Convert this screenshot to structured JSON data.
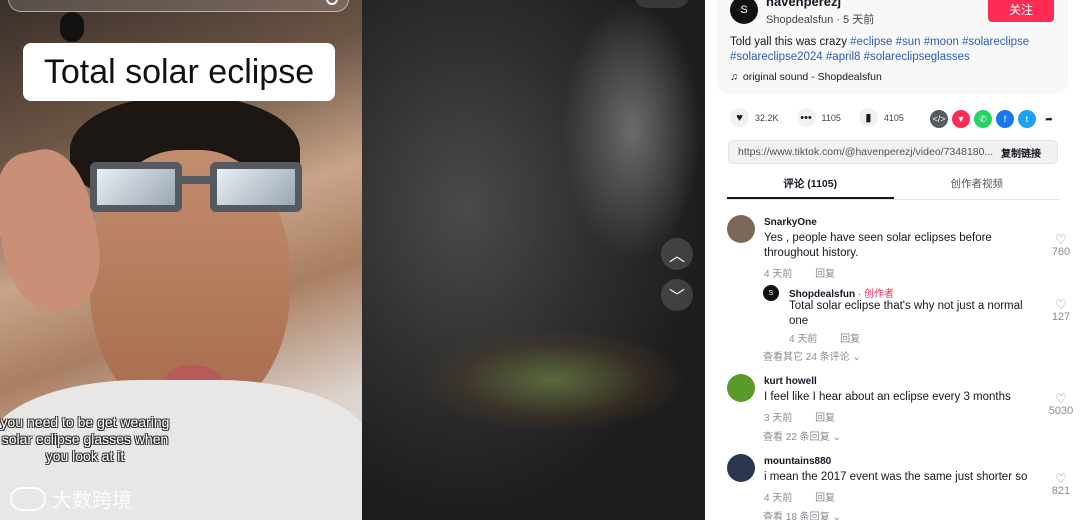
{
  "video": {
    "overlay_title": "Total solar eclipse",
    "caption": "you need to be get wearing solar eclipse glasses when you look at it",
    "watermark": "大数跨境"
  },
  "author": {
    "avatar_text": "S",
    "username": "havenperezj",
    "subline": "Shopdealsfun · 5 天前",
    "follow_label": "关注"
  },
  "post": {
    "text": "Told yall this was crazy",
    "hashtags": [
      "#eclipse",
      "#sun",
      "#moon",
      "#solareclipse",
      "#solareclipse2024",
      "#april8",
      "#solareclipseglasses"
    ],
    "music": "original sound - Shopdealsfun"
  },
  "stats": {
    "likes": "32.2K",
    "comments": "1105",
    "saves": "4105"
  },
  "share_icons": [
    {
      "name": "embed-icon",
      "glyph": "</>",
      "color": "#555a60"
    },
    {
      "name": "friends-share-icon",
      "glyph": "▼",
      "color": "#fe2c55"
    },
    {
      "name": "whatsapp-icon",
      "glyph": "✆",
      "color": "#25d366"
    },
    {
      "name": "facebook-icon",
      "glyph": "f",
      "color": "#1877f2"
    },
    {
      "name": "twitter-icon",
      "glyph": "t",
      "color": "#1da1f2"
    },
    {
      "name": "share-arrow-icon",
      "glyph": "➦",
      "color": "#161823"
    }
  ],
  "link": {
    "url": "https://www.tiktok.com/@havenperezj/video/7348180...",
    "copy_label": "复制链接"
  },
  "tabs": {
    "comments": "评论 (1105)",
    "creator_videos": "创作者视频"
  },
  "comments": [
    {
      "user": "SnarkyOne",
      "text": "Yes , people have seen solar eclipses before throughout history.",
      "time": "4 天前",
      "reply_label": "回复",
      "likes": "760",
      "avatar_color": "#7a6a55"
    },
    {
      "user": "kurt howell",
      "text": "I feel like I hear about an eclipse every 3 months",
      "time": "3 天前",
      "reply_label": "回复",
      "likes": "5030",
      "avatar_color": "#5a9a2a"
    },
    {
      "user": "mountains880",
      "text": "i mean the 2017 event was the same just shorter so",
      "time": "4 天前",
      "reply_label": "回复",
      "likes": "821",
      "avatar_color": "#2a3550"
    }
  ],
  "nested_reply": {
    "user": "Shopdealsfun",
    "creator_tag": " · 创作者",
    "text": "Total solar eclipse that's why not just a normal one",
    "time": "4 天前",
    "reply_label": "回复",
    "likes": "127",
    "more_replies": "查看其它 24 条评论"
  },
  "more_links": {
    "kurt": "查看 22 条回复",
    "mountains": "查看 18 条回复"
  }
}
